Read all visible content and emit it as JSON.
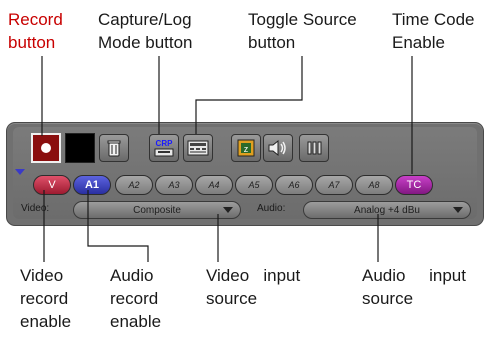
{
  "callouts": {
    "record_button": "Record\nbutton",
    "capture_log": "Capture/Log\nMode button",
    "toggle_source": "Toggle Source\nbutton",
    "timecode": "Time Code\nEnable",
    "video_record_enable": "Video\nrecord\nenable",
    "audio_record_enable": "Audio\nrecord\nenable",
    "video_input_source": "Video   input\nsource",
    "audio_input_source": "Audio     input\nsource"
  },
  "panel": {
    "tracks": [
      "V",
      "A1",
      "A2",
      "A3",
      "A4",
      "A5",
      "A6",
      "A7",
      "A8",
      "TC"
    ],
    "video_label": "Video:",
    "video_value": "Composite",
    "audio_label": "Audio:",
    "audio_value": "Analog +4 dBu",
    "crp_label": "CRP"
  },
  "colors": {
    "record_red": "#c80000",
    "video_track": "#c02840",
    "audio_track": "#3d44c8",
    "tc_track": "#a828a8"
  }
}
